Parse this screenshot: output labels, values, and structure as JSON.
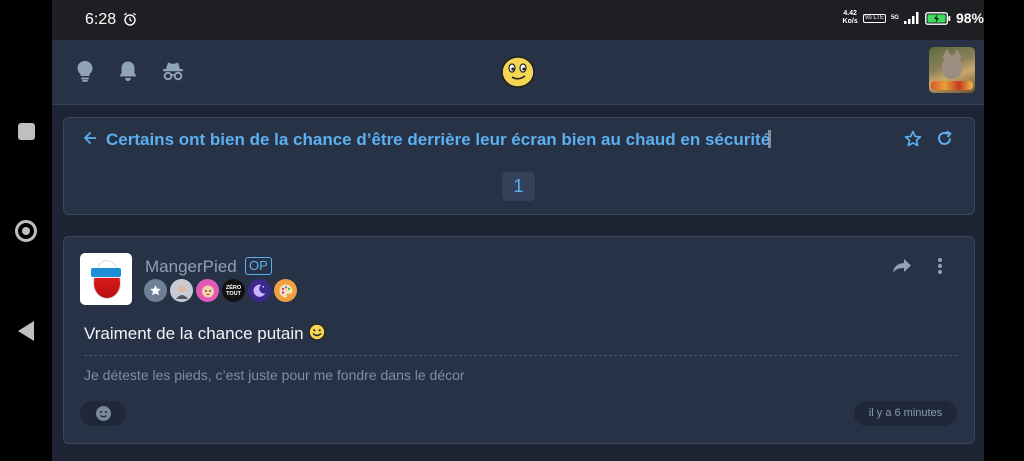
{
  "status_bar": {
    "time": "6:28",
    "net_speed_value": "4.42",
    "net_speed_unit": "Ko/s",
    "volte": "Vo LTE",
    "network": "5G",
    "battery": "98%"
  },
  "header": {
    "icons": [
      "lightbulb-icon",
      "bell-icon",
      "incognito-icon"
    ],
    "mascot": "smiley-mascot",
    "avatar": "user-avatar-cat"
  },
  "topic": {
    "title": "Certains ont bien de la chance d’être derrière leur écran bien au chaud en sécurité",
    "current_page": "1"
  },
  "post": {
    "author": "MangerPied",
    "op_label": "OP",
    "badges": [
      "star-badge",
      "portrait-badge",
      "baby-badge",
      "zero-tout-badge",
      "moon-badge",
      "palette-badge"
    ],
    "zero_tout_text": "ZÉRO TOUT",
    "body": "Vraiment de la chance putain",
    "signature": "Je déteste les pieds, c’est juste pour me fondre dans le décor",
    "time_ago": "il y a 6 minutes"
  },
  "colors": {
    "accent": "#5cb0f0",
    "card_bg": "#273246",
    "page_bg": "#1d2433"
  }
}
